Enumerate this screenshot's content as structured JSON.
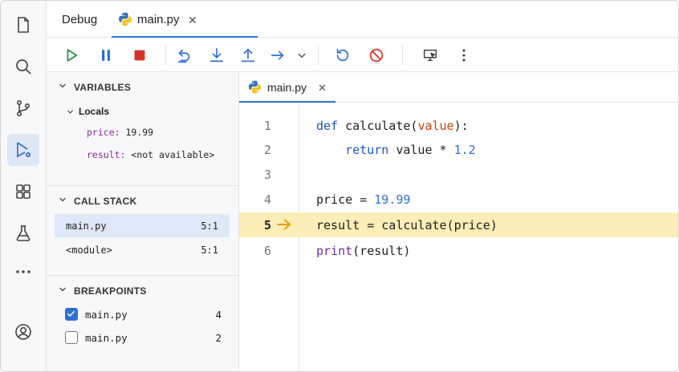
{
  "header": {
    "debug_label": "Debug",
    "tab_name": "main.py",
    "tab_close": "✕"
  },
  "sidebar": {
    "variables_title": "VARIABLES",
    "locals_label": "Locals",
    "variables": [
      {
        "name": "price",
        "value": "19.99"
      },
      {
        "name": "result",
        "value": "<not available>"
      }
    ],
    "callstack_title": "CALL STACK",
    "callstack": [
      {
        "name": "main.py",
        "pos": "5:1"
      },
      {
        "name": "<module>",
        "pos": "5:1"
      }
    ],
    "breakpoints_title": "BREAKPOINTS",
    "breakpoints": [
      {
        "file": "main.py",
        "line": "4",
        "checked": true
      },
      {
        "file": "main.py",
        "line": "2",
        "checked": false
      }
    ]
  },
  "editor": {
    "tab_name": "main.py",
    "tab_close": "✕",
    "current_line": 5,
    "lines": [
      {
        "num": "1"
      },
      {
        "num": "2"
      },
      {
        "num": "3"
      },
      {
        "num": "4"
      },
      {
        "num": "5"
      },
      {
        "num": "6"
      }
    ],
    "tokens": {
      "l1_def": "def",
      "l1_fn": "calculate",
      "l1_open": "(",
      "l1_param": "value",
      "l1_close": "):",
      "l2_return": "return",
      "l2_expr": "value * ",
      "l2_num": "1.2",
      "l4_lhs": "price = ",
      "l4_num": "19.99",
      "l5_code": "result = calculate(price)",
      "l6_print": "print",
      "l6_rest": "(result)"
    }
  },
  "colors": {
    "accent": "#2f6fd6",
    "current_line": "#fbeeb6",
    "run_green": "#1e8e3e",
    "stop_red": "#d93025",
    "arrow_amber": "#e3a008"
  }
}
